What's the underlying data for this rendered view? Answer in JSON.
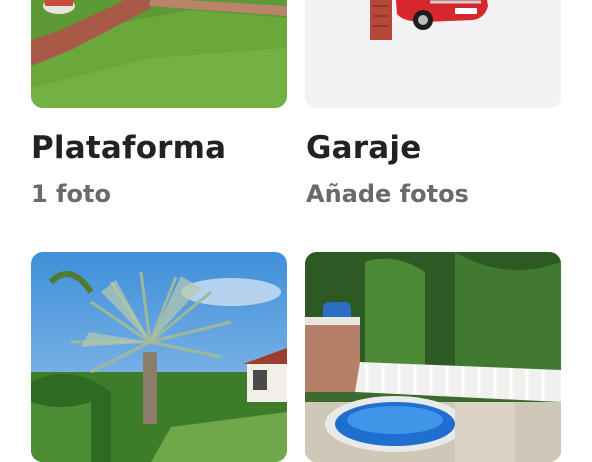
{
  "rooms": [
    {
      "title": "Plataforma",
      "subtitle": "1 foto"
    },
    {
      "title": "Garaje",
      "subtitle": "Añade fotos"
    },
    {
      "title": "",
      "subtitle": ""
    },
    {
      "title": "",
      "subtitle": ""
    }
  ]
}
